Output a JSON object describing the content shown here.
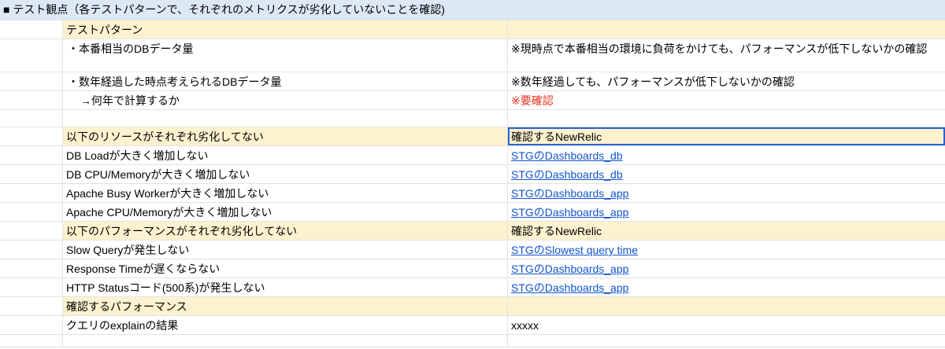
{
  "title": "■ テスト観点（各テストパターンで、それぞれのメトリクスが劣化していないことを確認)",
  "sections": {
    "pattern_header": "テストパターン",
    "pattern1_label": "・本番相当のDBデータ量",
    "pattern1_note": "※現時点で本番相当の環境に負荷をかけても、パフォーマンスが低下しないかの確認",
    "pattern2_label": "・数年経過した時点考えられるDBデータ量",
    "pattern2_note": "※数年経過しても、パフォーマンスが低下しないかの確認",
    "pattern2_sub": "→何年で計算するか",
    "pattern2_sub_note": "※要確認",
    "resources_header": "以下のリソースがそれぞれ劣化してない",
    "resources_header_right": "確認するNewRelic",
    "performance_header": "以下のパフォーマンスがそれぞれ劣化してない",
    "performance_header_right": "確認するNewRelic",
    "confirm_header": "確認するパフォーマンス",
    "explain_label": "クエリのexplainの結果",
    "explain_value": "xxxxx"
  },
  "resources": [
    {
      "label": "DB Loadが大きく増加しない",
      "link": "STGのDashboards_db"
    },
    {
      "label": "DB CPU/Memoryが大きく増加しない",
      "link": "STGのDashboards_db"
    },
    {
      "label": "Apache Busy Workerが大きく増加しない",
      "link": "STGのDashboards_app"
    },
    {
      "label": "Apache CPU/Memoryが大きく増加しない",
      "link": "STGのDashboards_app"
    }
  ],
  "performance": [
    {
      "label": "Slow Queryが発生しない",
      "link": "STGのSlowest query time"
    },
    {
      "label": "Response Timeが遅くならない",
      "link": "STGのDashboards_app"
    },
    {
      "label": "HTTP Statusコード(500系)が発生しない",
      "link": "STGのDashboards_app"
    }
  ],
  "colors": {
    "title_bg": "#dde8f5",
    "section_bg": "#fdf2d0",
    "link": "#1155cc",
    "warning": "#e8301c",
    "selection": "#2a63cf",
    "grid": "#e2e2e2"
  }
}
